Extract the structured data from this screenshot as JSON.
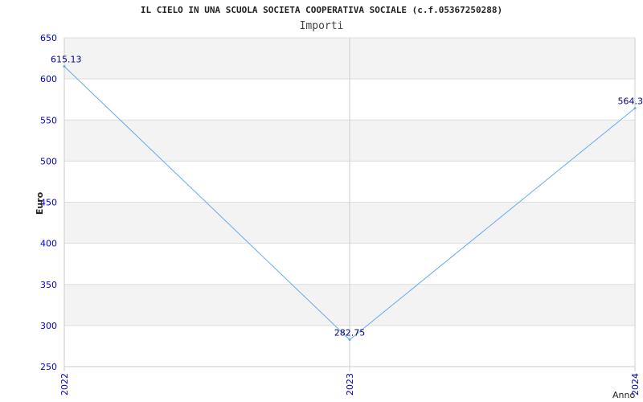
{
  "chart_data": {
    "type": "line",
    "title": "IL CIELO IN UNA SCUOLA SOCIETA COOPERATIVA SOCIALE (c.f.05367250288)",
    "subtitle": "Importi",
    "xlabel": "Anno",
    "ylabel": "Euro",
    "categories": [
      "2022",
      "2023",
      "2024"
    ],
    "series": [
      {
        "values": [
          615.13,
          282.75,
          564.3
        ],
        "labels": [
          "615.13",
          "282.75",
          "564.3"
        ]
      }
    ],
    "ylim": [
      250,
      650
    ],
    "yticks": [
      250,
      300,
      350,
      400,
      450,
      500,
      550,
      600,
      650
    ],
    "grid": true,
    "colors": {
      "line": "#66aaee",
      "tick_label": "#0000cc",
      "band": "#f3f3f3",
      "grid": "#dddddd",
      "axis": "#cccccc"
    }
  }
}
